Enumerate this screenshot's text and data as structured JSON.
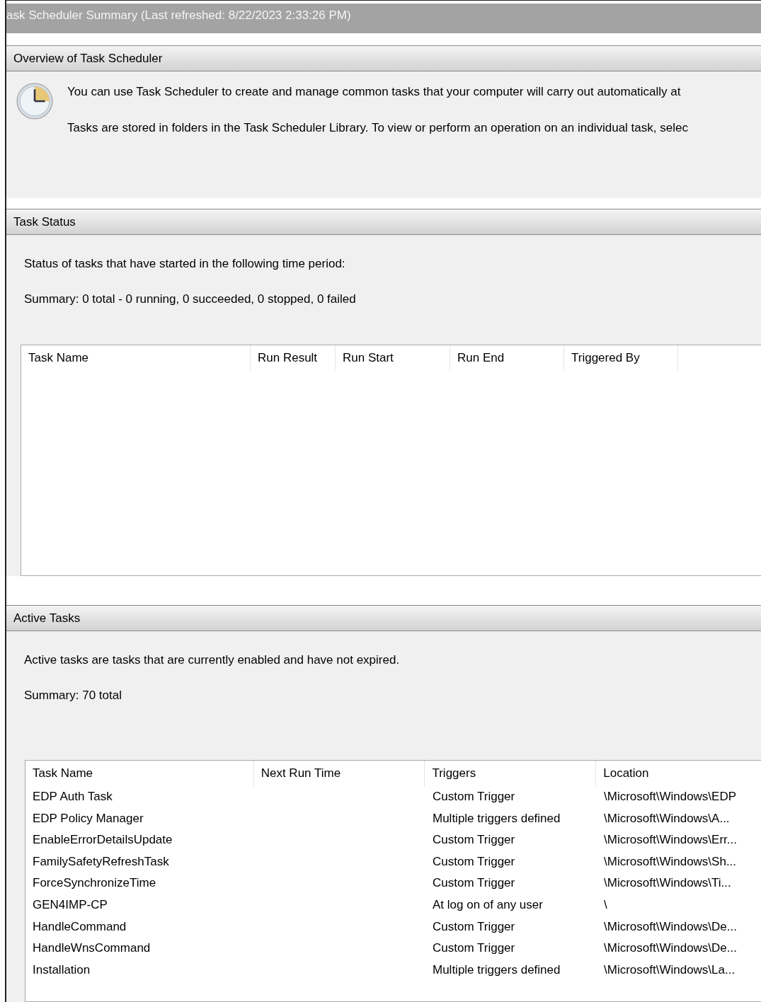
{
  "window": {
    "title": "ask Scheduler Summary (Last refreshed: 8/22/2023 2:33:26 PM)"
  },
  "overview": {
    "heading": "Overview of Task Scheduler",
    "paragraphs": [
      "You can use Task Scheduler to create and manage common tasks that your computer will carry out automatically at",
      "Tasks are stored in folders in the Task Scheduler Library. To view or perform an operation on an individual task, selec"
    ]
  },
  "task_status": {
    "heading": "Task Status",
    "period_label": "Status of tasks that have started in the following time period:",
    "summary": "Summary: 0 total - 0 running, 0 succeeded, 0 stopped, 0 failed",
    "table": {
      "columns": [
        "Task Name",
        "Run Result",
        "Run Start",
        "Run End",
        "Triggered By"
      ]
    }
  },
  "active_tasks": {
    "heading": "Active Tasks",
    "description": "Active tasks are tasks that are currently enabled and have not expired.",
    "summary": "Summary: 70 total",
    "table": {
      "columns": [
        "Task Name",
        "Next Run Time",
        "Triggers",
        "Location"
      ],
      "rows": [
        [
          "EDP Auth Task",
          "",
          "Custom Trigger",
          "\\Microsoft\\Windows\\EDP"
        ],
        [
          "EDP Policy Manager",
          "",
          "Multiple triggers defined",
          "\\Microsoft\\Windows\\A..."
        ],
        [
          "EnableErrorDetailsUpdate",
          "",
          "Custom Trigger",
          "\\Microsoft\\Windows\\Err..."
        ],
        [
          "FamilySafetyRefreshTask",
          "",
          "Custom Trigger",
          "\\Microsoft\\Windows\\Sh..."
        ],
        [
          "ForceSynchronizeTime",
          "",
          "Custom Trigger",
          "\\Microsoft\\Windows\\Ti..."
        ],
        [
          "GEN4IMP-CP",
          "",
          "At log on of any user",
          "\\"
        ],
        [
          "HandleCommand",
          "",
          "Custom Trigger",
          "\\Microsoft\\Windows\\De..."
        ],
        [
          "HandleWnsCommand",
          "",
          "Custom Trigger",
          "\\Microsoft\\Windows\\De..."
        ],
        [
          "Installation",
          "",
          "Multiple triggers defined",
          "\\Microsoft\\Windows\\La..."
        ]
      ]
    }
  }
}
